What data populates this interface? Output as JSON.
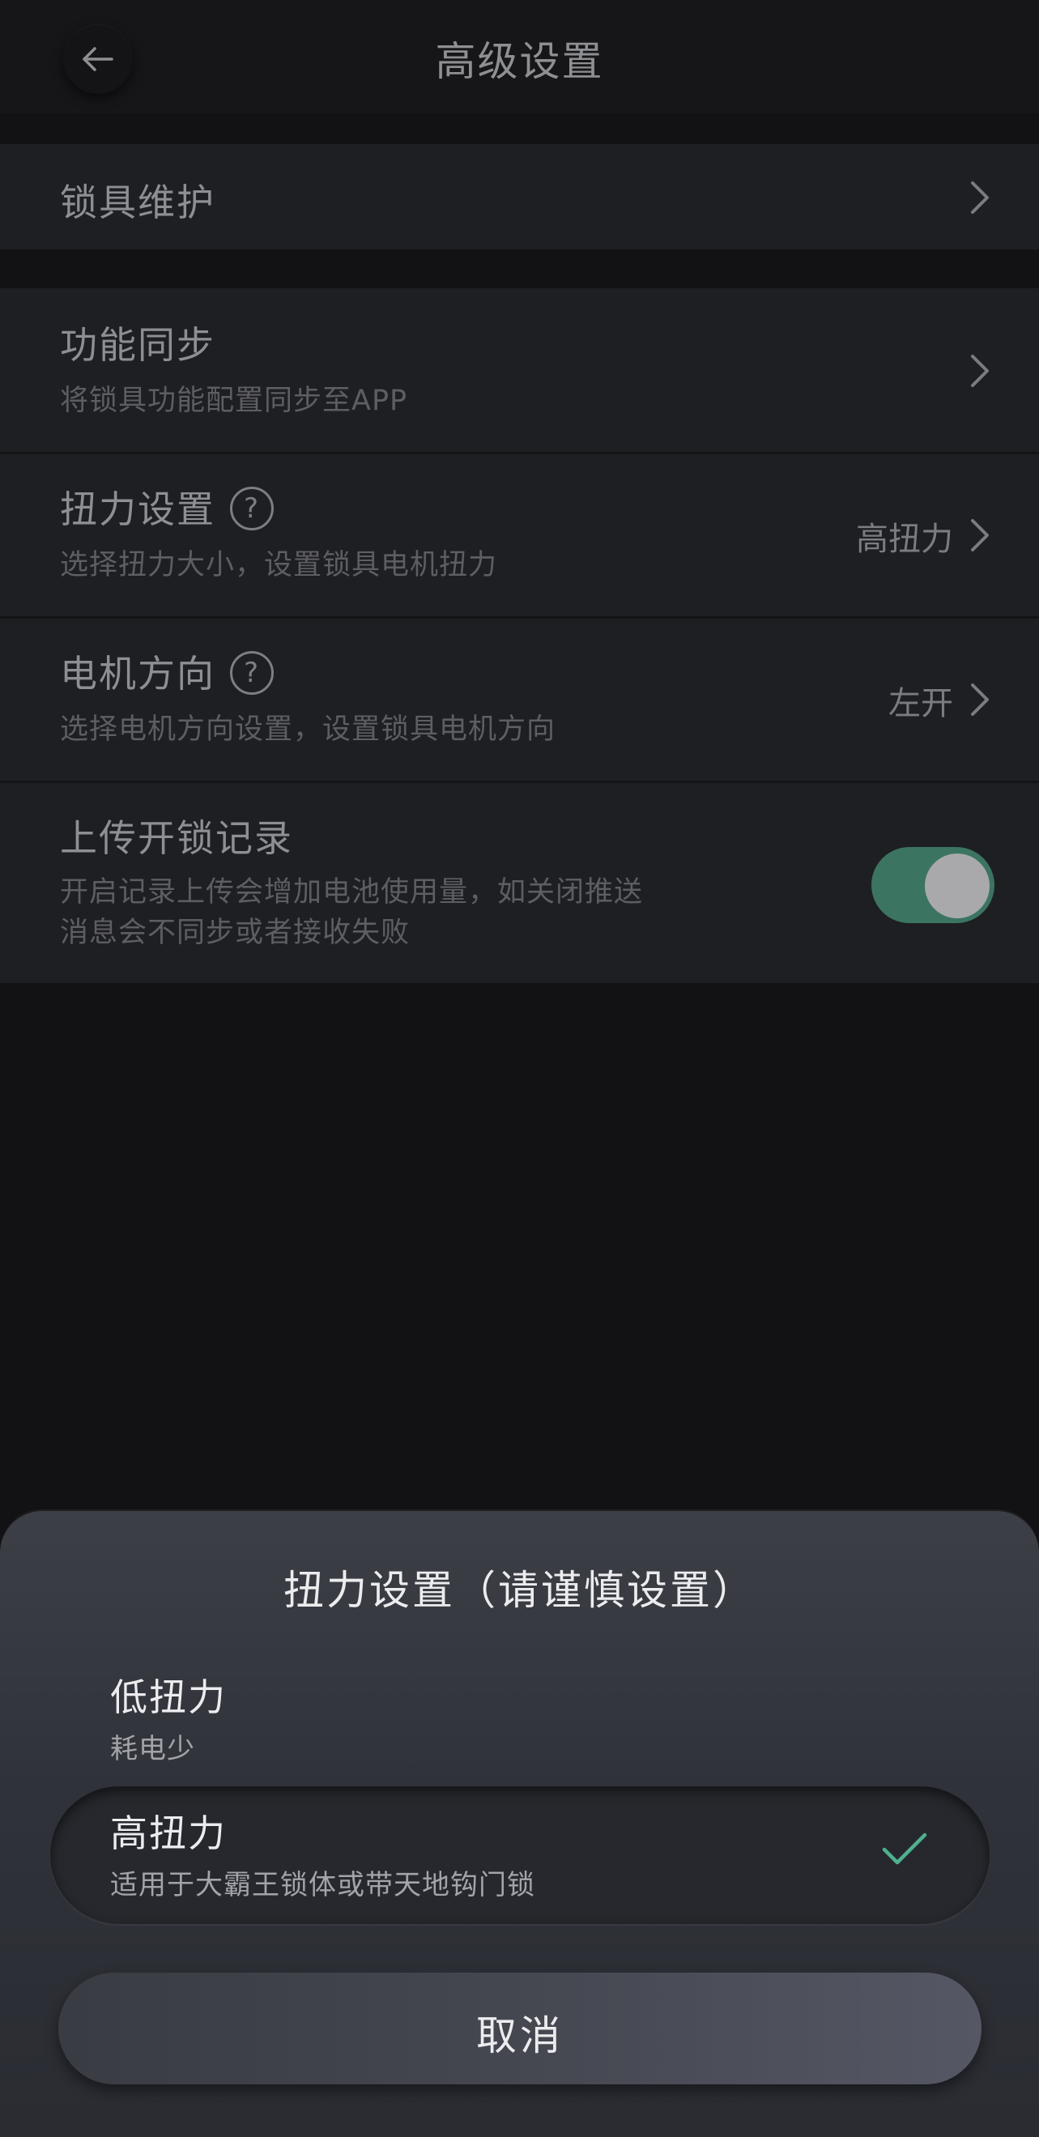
{
  "header": {
    "title": "高级设置"
  },
  "settings": {
    "lock_maintenance": {
      "title": "锁具维护"
    },
    "function_sync": {
      "title": "功能同步",
      "subtitle": "将锁具功能配置同步至APP"
    },
    "torque": {
      "title": "扭力设置",
      "help": "?",
      "subtitle": "选择扭力大小，设置锁具电机扭力",
      "value": "高扭力"
    },
    "motor_direction": {
      "title": "电机方向",
      "help": "?",
      "subtitle": "选择电机方向设置，设置锁具电机方向",
      "value": "左开"
    },
    "upload_records": {
      "title": "上传开锁记录",
      "subtitle_line1": "开启记录上传会增加电池使用量，如关闭推送",
      "subtitle_line2": "消息会不同步或者接收失败",
      "enabled": true
    }
  },
  "sheet": {
    "title": "扭力设置（请谨慎设置）",
    "options": [
      {
        "title": "低扭力",
        "subtitle": "耗电少",
        "selected": false
      },
      {
        "title": "高扭力",
        "subtitle": "适用于大霸王锁体或带天地钩门锁",
        "selected": true
      }
    ],
    "cancel_label": "取消"
  },
  "colors": {
    "accent_green": "#3c7462",
    "check_green": "#4fb08e"
  }
}
